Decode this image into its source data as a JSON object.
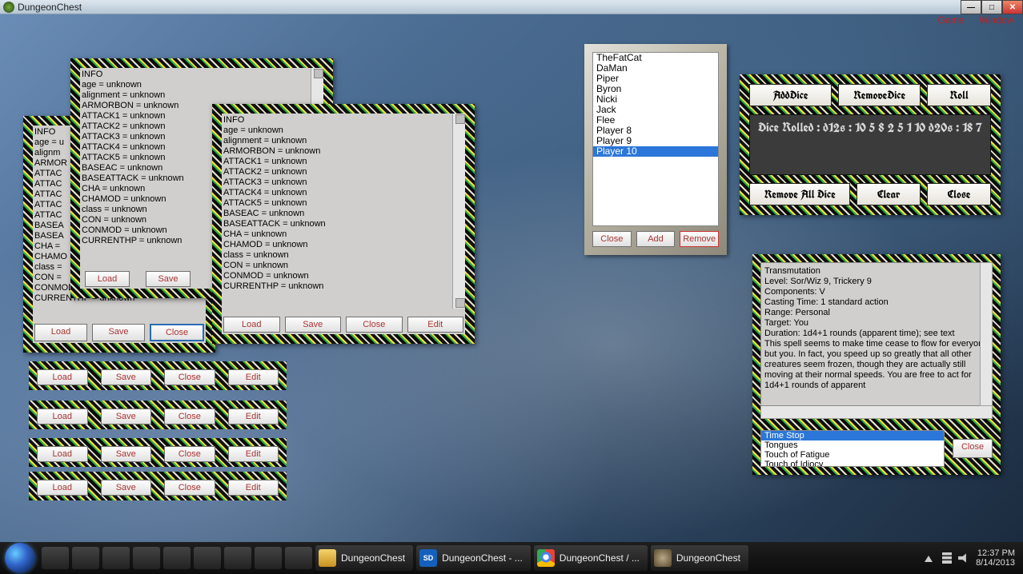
{
  "window": {
    "title": "DungeonChest"
  },
  "menu": {
    "game": "Game",
    "window": "Window"
  },
  "sheet_info": "INFO\nage = unknown\nalignment = unknown\nARMORBON = unknown\nATTACK1 = unknown\nATTACK2 = unknown\nATTACK3 = unknown\nATTACK4 = unknown\nATTACK5 = unknown\nBASEAC = unknown\nBASEATTACK = unknown\nCHA = unknown\nCHAMOD = unknown\nclass = unknown\nCON = unknown\nCONMOD = unknown\nCURRENTHP = unknown",
  "sheet_info_partial": "INFO\nage = u\nalignm\nARMOR\nATTAC\nATTAC\nATTAC\nATTAC\nATTAC\nBASEA\nBASEA\nCHA =\nCHAMO\nclass =\nCON =\nCONMOD = unknown\nCURRENTHP = unknown",
  "buttons": {
    "load": "Load",
    "save": "Save",
    "close": "Close",
    "edit": "Edit",
    "add": "Add",
    "remove": "Remove"
  },
  "players": [
    "TheFatCat",
    "DaMan",
    "Piper",
    "Byron",
    "Nicki",
    "Jack",
    "Flee",
    "Player 8",
    "Player 9",
    "Player 10"
  ],
  "players_selected": 9,
  "dice": {
    "add": "AddDice",
    "remove": "RemoveDice",
    "roll": "Roll",
    "remove_all": "Remove All Dice",
    "clear": "Clear",
    "close": "Close",
    "output": "Dice Rolled : d12s : 10 5 8 2 5 1 10 d20s : 18 7"
  },
  "spell": {
    "text": "Transmutation\nLevel: Sor/Wiz 9, Trickery 9\nComponents: V\nCasting Time: 1 standard action\nRange: Personal\nTarget: You\nDuration: 1d4+1 rounds (apparent time); see text\nThis spell seems to make time cease to flow for everyone but you. In fact, you speed up so greatly that all other creatures seem frozen, though they are actually still moving at their normal speeds. You are free to act for 1d4+1 rounds of apparent",
    "list": [
      "Time Stop",
      "Tongues",
      "Touch of Fatigue",
      "Touch of Idiocy"
    ],
    "selected": 0,
    "close": "Close"
  },
  "taskbar": {
    "items": [
      "DungeonChest",
      "DungeonChest - ...",
      "DungeonChest / ...",
      "DungeonChest"
    ],
    "time": "12:37 PM",
    "date": "8/14/2013"
  }
}
